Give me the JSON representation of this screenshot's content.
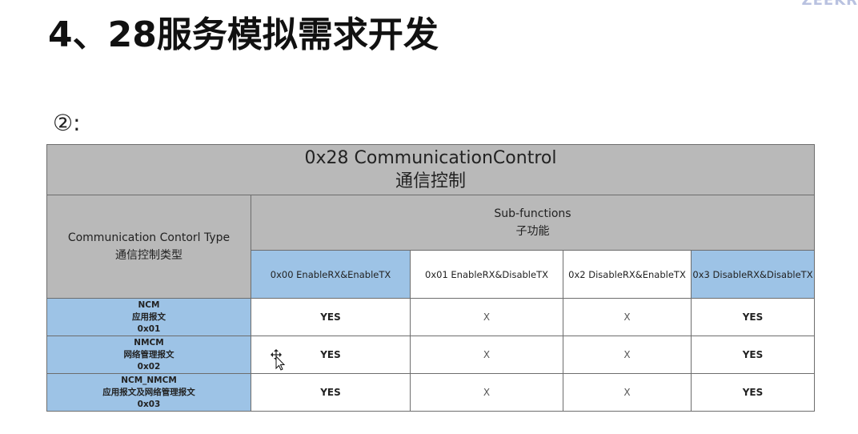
{
  "slide": {
    "title": "4、28服务模拟需求开发",
    "subsection": "②:"
  },
  "table": {
    "title_en": "0x28 CommunicationControl",
    "title_cn": "通信控制",
    "type_header_en": "Communication Contorl Type",
    "type_header_cn": "通信控制类型",
    "sub_header_en": "Sub-functions",
    "sub_header_cn": "子功能",
    "subfunctions": [
      "0x00 EnableRX&EnableTX",
      "0x01 EnableRX&DisableTX",
      "0x2 DisableRX&EnableTX",
      "0x3 DisableRX&DisableTX"
    ],
    "rows": [
      {
        "name": "NCM",
        "cn": "应用报文",
        "code": "0x01",
        "cells": [
          "YES",
          "X",
          "X",
          "YES"
        ]
      },
      {
        "name": "NMCM",
        "cn": "网络管理报文",
        "code": "0x02",
        "cells": [
          "YES",
          "X",
          "X",
          "YES"
        ]
      },
      {
        "name": "NCM_NMCM",
        "cn": "应用报文及网络管理报文",
        "code": "0x03",
        "cells": [
          "YES",
          "X",
          "X",
          "YES"
        ]
      }
    ]
  },
  "colors": {
    "header_gray": "#b9b9b9",
    "header_blue": "#9dc3e6",
    "border": "#6d6d6d"
  }
}
